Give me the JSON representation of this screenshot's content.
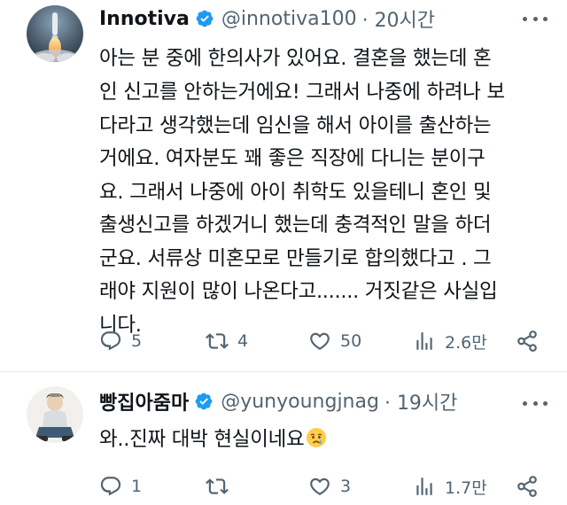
{
  "tweet1": {
    "name": "Innotiva",
    "handle": "@innotiva100",
    "time": "· 20시간",
    "body_lines": [
      "아는 분 중에 한의사가 있어요. 결혼을 했는데 혼",
      "인 신고를 안하는거에요! 그래서 나중에 하려나 보",
      "다라고 생각했는데 임신을 해서 아이를 출산하는",
      "거에요. 여자분도 꽤 좋은 직장에 다니는 분이구",
      "요. 그래서 나중에 아이 취학도 있을테니 혼인 및",
      "출생신고를 하겠거니 했는데 충격적인 말을 하더",
      "군요. 서류상 미혼모로 만들기로 합의했다고 . 그",
      "래야 지원이 많이 나온다고....... 거짓같은 사실입",
      "니다."
    ],
    "replies": "5",
    "retweets": "4",
    "likes": "50",
    "views": "2.6만"
  },
  "tweet2": {
    "name": "빵집아줌마",
    "handle": "@yunyoungjnag",
    "time": "· 19시간",
    "body": "와..진짜 대박 현실이네요",
    "emoji": "crying-face",
    "replies": "1",
    "retweets": "",
    "likes": "3",
    "views": "1.7만"
  },
  "colors": {
    "text": "#0f1419",
    "secondary": "#536471",
    "verified": "#1d9bf0",
    "divider": "#e4e8eb"
  },
  "icons": [
    "rocket-avatar",
    "person-avatar",
    "verified-badge-icon",
    "more-icon",
    "reply-icon",
    "retweet-icon",
    "like-icon",
    "views-icon",
    "share-icon",
    "crying-face-emoji"
  ]
}
